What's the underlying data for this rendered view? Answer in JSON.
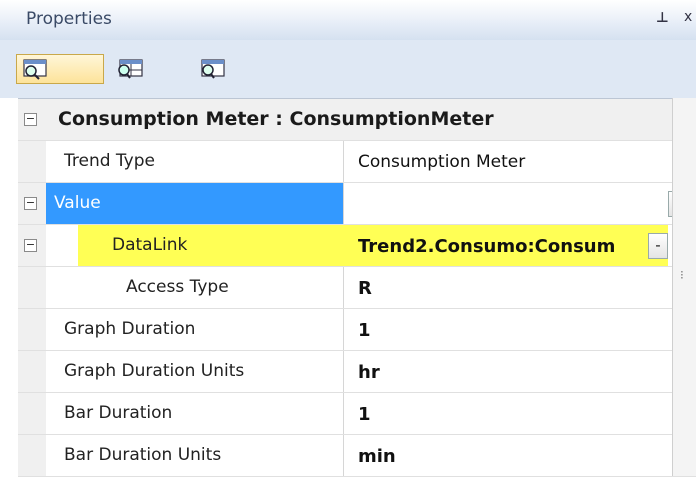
{
  "panel": {
    "title": "Properties",
    "pin_glyph": "ᵖ",
    "close_glyph": "x"
  },
  "toolbar": {
    "buttons": [
      {
        "name": "properties-view-button",
        "icon": "properties-view-icon",
        "active": true
      },
      {
        "name": "add-properties-button",
        "icon": "add-properties-icon",
        "active": false
      },
      {
        "name": "properties-alt-button",
        "icon": "properties-alt-icon",
        "active": false
      }
    ]
  },
  "category": {
    "expander": "−",
    "label": "Consumption Meter : ConsumptionMeter"
  },
  "rows": {
    "trend_type": {
      "name": "Trend Type",
      "value": "Consumption Meter"
    },
    "value": {
      "name": "Value",
      "value": "",
      "expander": "−",
      "button": "+"
    },
    "datalink": {
      "name": "DataLink",
      "value": "Trend2.Consumo:Consum",
      "expander": "−",
      "button": "-"
    },
    "access_type": {
      "name": "Access Type",
      "value": "R"
    },
    "graph_duration": {
      "name": "Graph Duration",
      "value": "1"
    },
    "graph_duration_units": {
      "name": "Graph Duration Units",
      "value": "hr"
    },
    "bar_duration": {
      "name": "Bar Duration",
      "value": "1"
    },
    "bar_duration_units": {
      "name": "Bar Duration Units",
      "value": "min"
    }
  },
  "colors": {
    "selection": "#3399ff",
    "highlight": "#ffff55",
    "toolbar_bg": "#dfe8f4"
  }
}
